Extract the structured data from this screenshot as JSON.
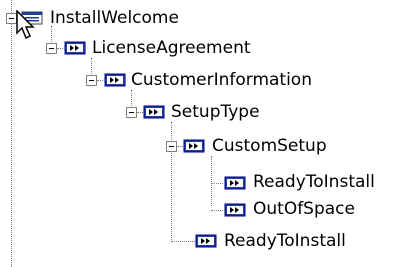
{
  "tree": {
    "nodes": [
      {
        "label": "InstallWelcome",
        "icon": "dialog-window-icon",
        "expanded": true
      },
      {
        "label": "LicenseAgreement",
        "icon": "next-dialog-icon",
        "expanded": true
      },
      {
        "label": "CustomerInformation",
        "icon": "next-dialog-icon",
        "expanded": true
      },
      {
        "label": "SetupType",
        "icon": "next-dialog-icon",
        "expanded": true
      },
      {
        "label": "CustomSetup",
        "icon": "next-dialog-icon",
        "expanded": true
      },
      {
        "label": "ReadyToInstall",
        "icon": "next-dialog-icon",
        "expanded": false
      },
      {
        "label": "OutOfSpace",
        "icon": "next-dialog-icon",
        "expanded": false
      },
      {
        "label": "ReadyToInstall",
        "icon": "next-dialog-icon",
        "expanded": false
      }
    ]
  },
  "colors": {
    "icon_blue": "#1f3fa0",
    "icon_border": "#000080",
    "tree_line": "#808080"
  }
}
